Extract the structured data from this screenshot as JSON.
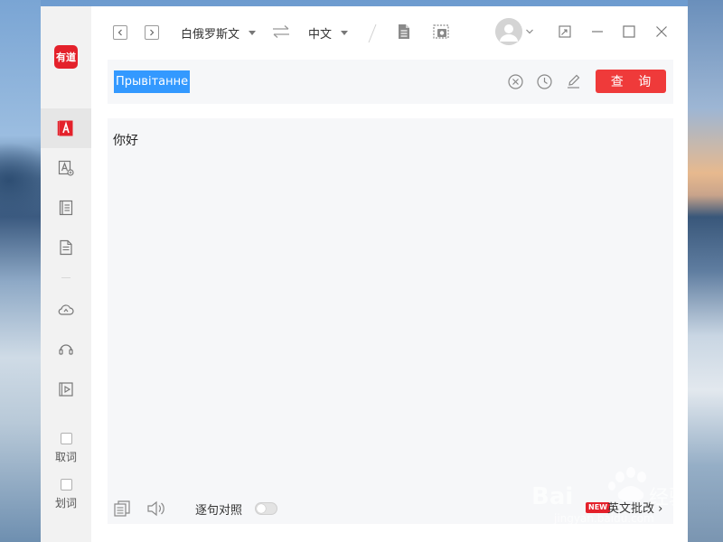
{
  "app": {
    "logo_text": "有道",
    "brand_color": "#e4212b"
  },
  "sidebar": {
    "items": [
      {
        "name": "text-translate-icon",
        "active": true
      },
      {
        "name": "image-translate-icon",
        "active": false
      },
      {
        "name": "dictionary-book-icon",
        "active": false
      },
      {
        "name": "document-translate-icon",
        "active": false
      },
      {
        "name": "cloud-icon",
        "active": false
      },
      {
        "name": "headset-icon",
        "active": false
      },
      {
        "name": "video-play-icon",
        "active": false
      }
    ],
    "checks": [
      {
        "label": "取词",
        "checked": false
      },
      {
        "label": "划词",
        "checked": false
      }
    ]
  },
  "topbar": {
    "source_lang": "白俄罗斯文",
    "target_lang": "中文",
    "icons": [
      "back-icon",
      "forward-icon",
      "swap-icon",
      "document-icon",
      "screenshot-icon",
      "avatar-icon",
      "shrink-icon",
      "minimize-icon",
      "maximize-icon",
      "close-icon"
    ]
  },
  "input": {
    "value": "Прывітанне",
    "query_label": "查 询",
    "query_color": "#ef3a3a",
    "icons": [
      "clear-icon",
      "history-icon",
      "handwriting-icon"
    ]
  },
  "result": {
    "text": "你好",
    "sentence_compare_label": "逐句对照",
    "sentence_compare_on": false,
    "new_badge": "NEW",
    "batch_label": "英文批改 ›"
  }
}
